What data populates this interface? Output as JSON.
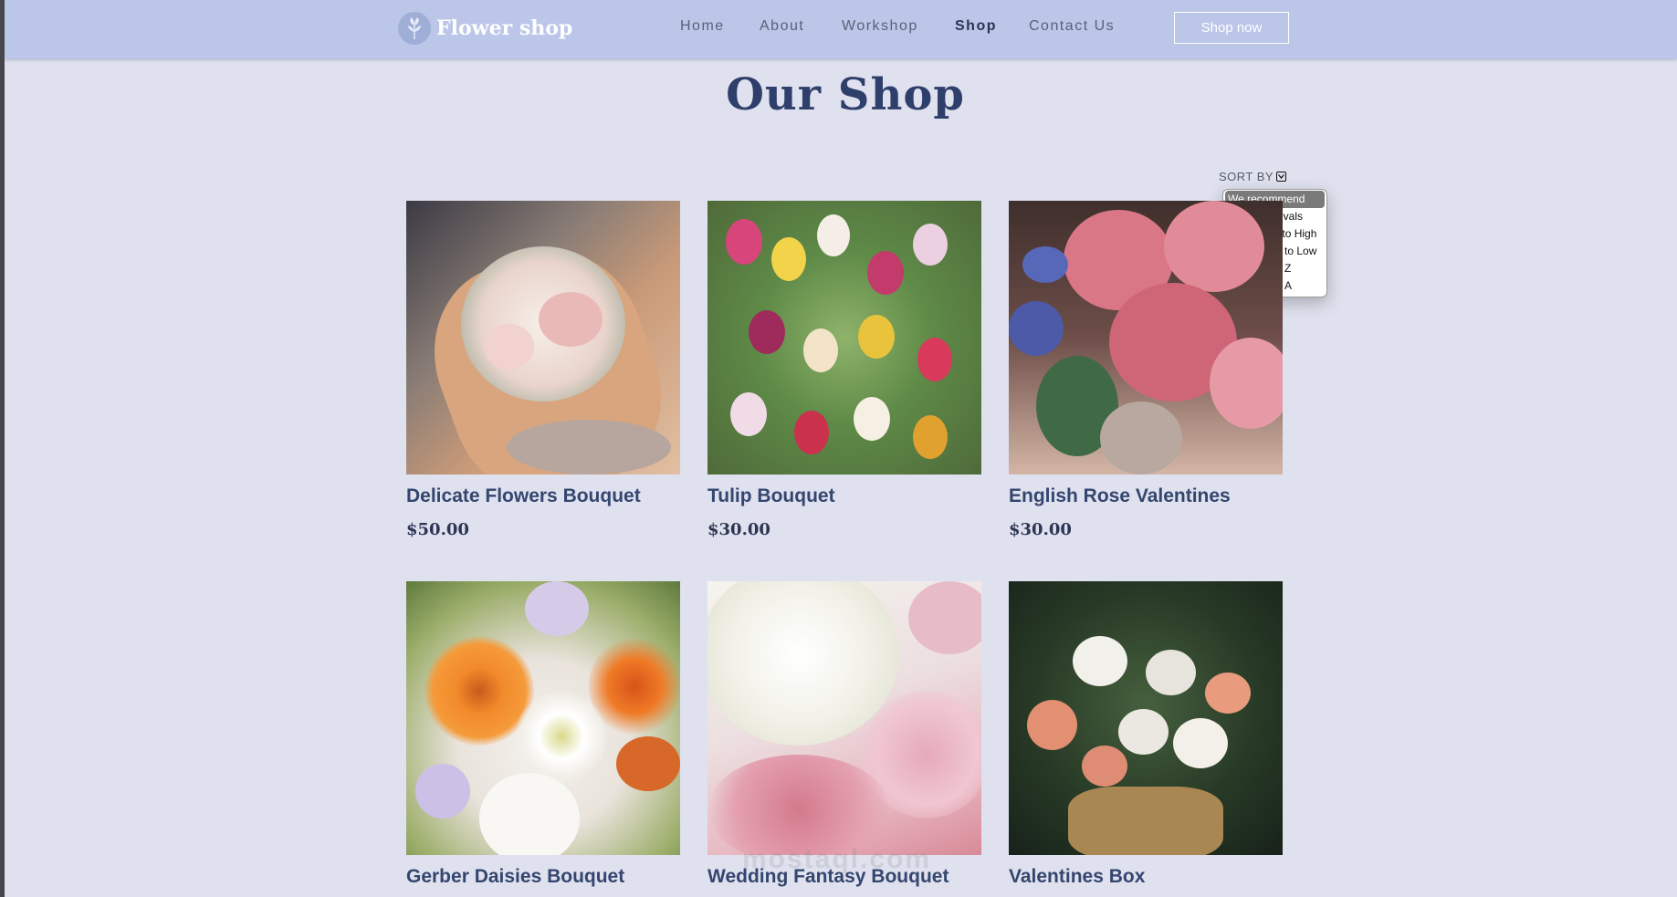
{
  "header": {
    "logo_text": "Flower shop",
    "nav": [
      {
        "label": "Home",
        "active": false
      },
      {
        "label": "About",
        "active": false
      },
      {
        "label": "Workshop",
        "active": false
      },
      {
        "label": "Shop",
        "active": true
      },
      {
        "label": "Contact Us",
        "active": false
      }
    ],
    "cta_label": "Shop now"
  },
  "main": {
    "title": "Our Shop",
    "sort": {
      "label": "SORT BY",
      "options": [
        "We recommend",
        "Newest arrivals",
        "Price: Low to High",
        "Price: High to Low",
        "Name: A to Z",
        "Name: Z to A"
      ],
      "selected": "We recommend"
    },
    "products": [
      {
        "name": "Delicate Flowers Bouquet",
        "price": "$50.00"
      },
      {
        "name": "Tulip Bouquet",
        "price": "$30.00"
      },
      {
        "name": "English Rose Valentines",
        "price": "$30.00"
      },
      {
        "name": "Gerber Daisies Bouquet",
        "price": ""
      },
      {
        "name": "Wedding Fantasy Bouquet",
        "price": ""
      },
      {
        "name": "Valentines Box",
        "price": ""
      }
    ]
  },
  "watermark": "mostaql.com",
  "colors": {
    "header_bg": "#bbc6e8",
    "page_bg": "#dfe1ee",
    "title": "#2f3f6b",
    "product_name": "#34466f"
  }
}
